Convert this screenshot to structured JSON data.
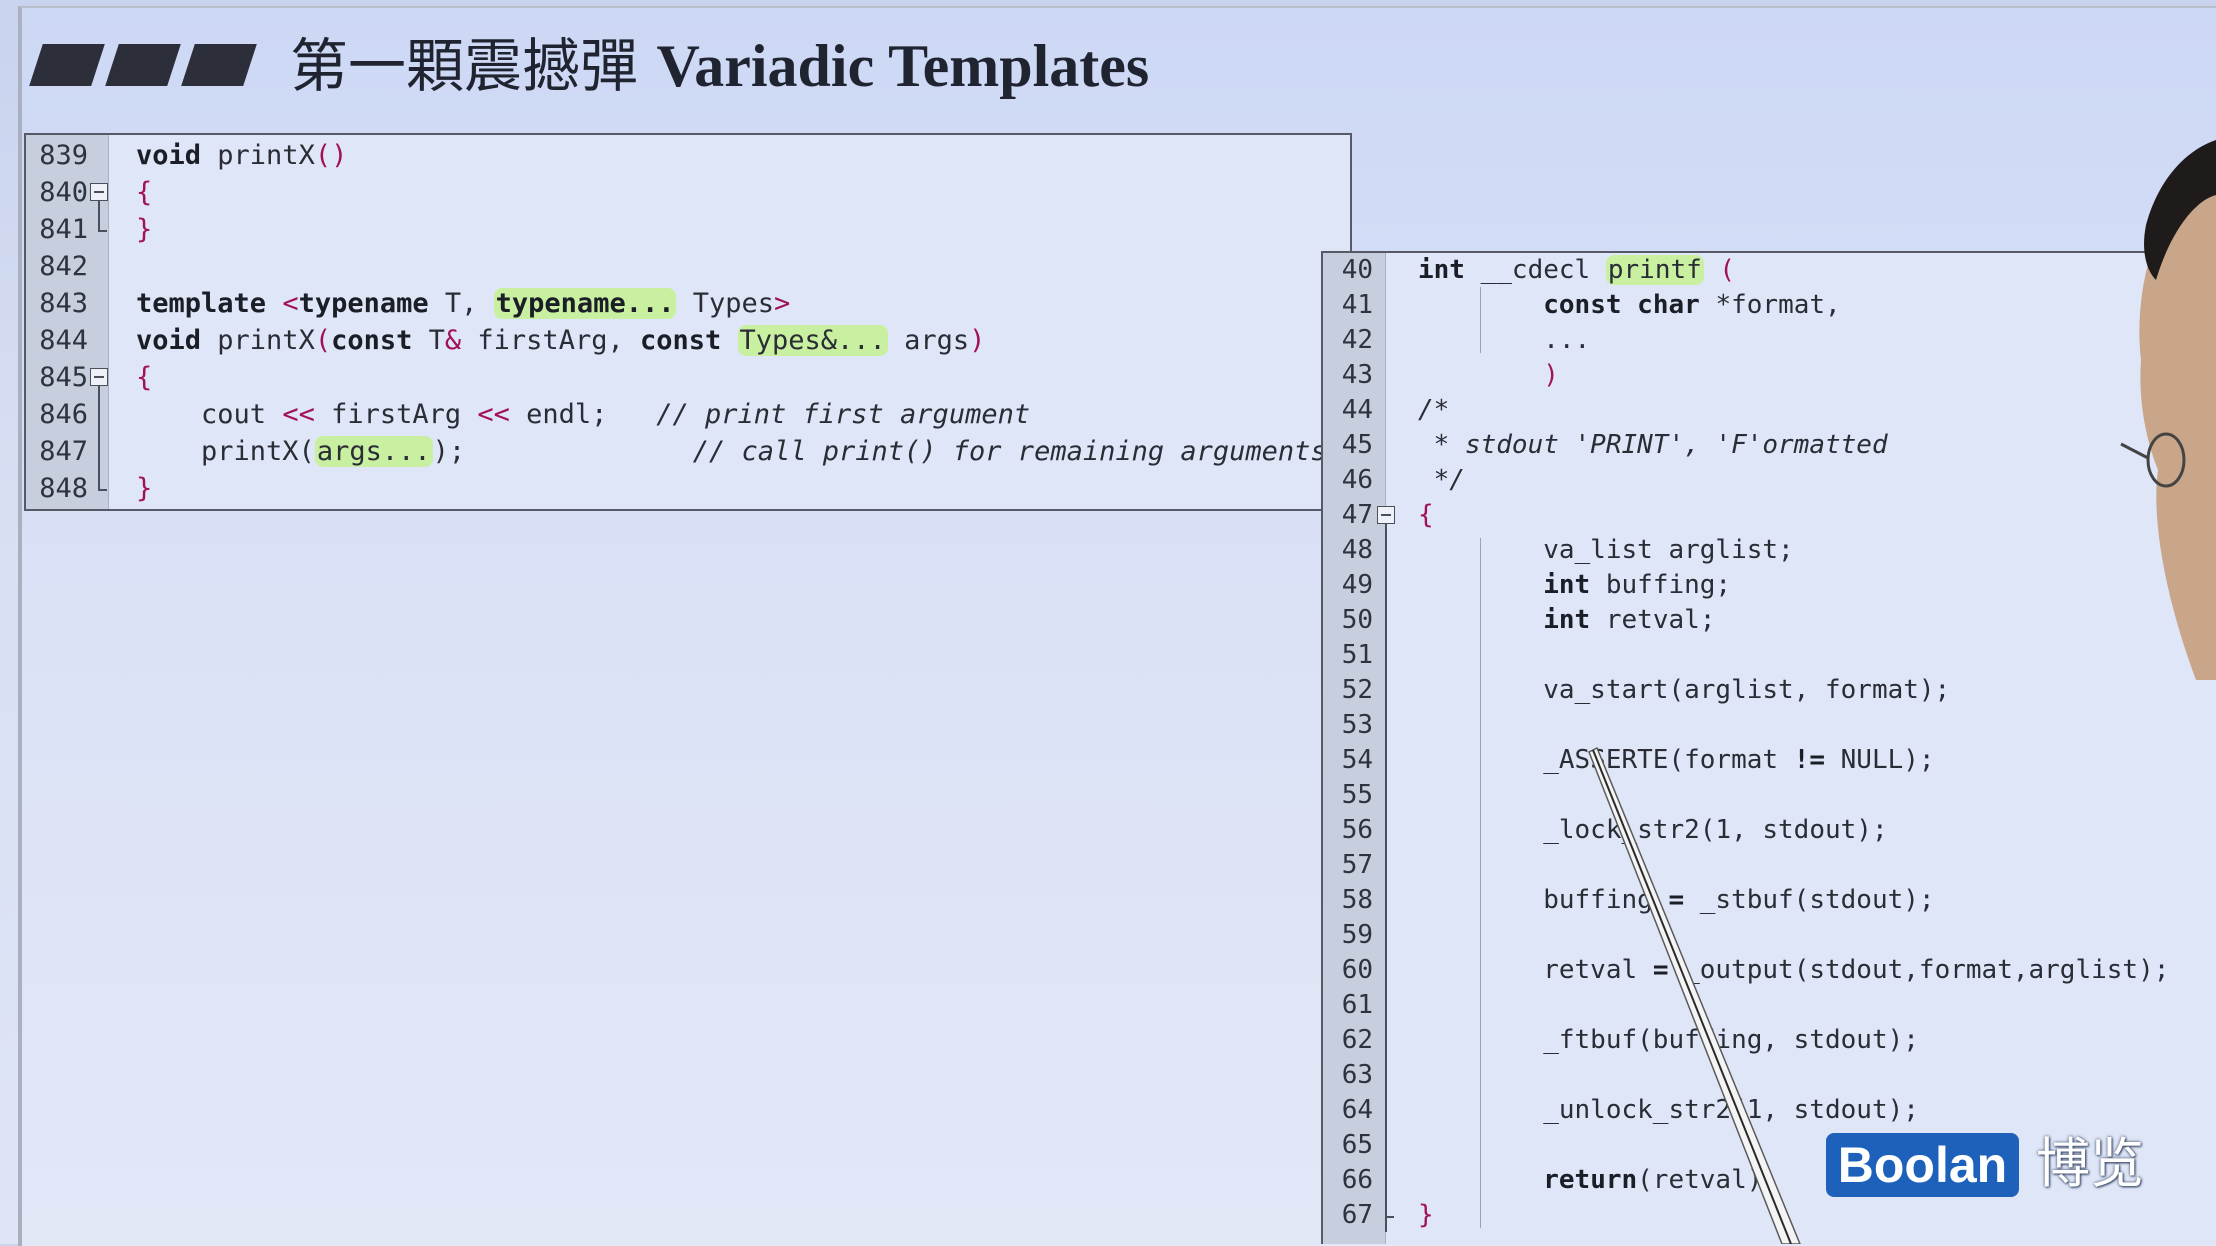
{
  "slide": {
    "title_cn": "第一顆震撼彈 ",
    "title_en": "Variadic Templates"
  },
  "left_code": {
    "lines": [
      {
        "num": "839",
        "parts": [
          {
            "t": "void",
            "c": "kw"
          },
          {
            "t": " printX",
            "c": ""
          },
          {
            "t": "()",
            "c": "pn"
          }
        ]
      },
      {
        "num": "840",
        "fold": "open",
        "parts": [
          {
            "t": "{",
            "c": "pn"
          }
        ]
      },
      {
        "num": "841",
        "fold": "end",
        "parts": [
          {
            "t": "}",
            "c": "pn"
          }
        ]
      },
      {
        "num": "842",
        "parts": []
      },
      {
        "num": "843",
        "parts": [
          {
            "t": "template",
            "c": "kw"
          },
          {
            "t": " ",
            "c": ""
          },
          {
            "t": "<",
            "c": "pn"
          },
          {
            "t": "typename",
            "c": "kw"
          },
          {
            "t": " T, ",
            "c": ""
          },
          {
            "t": "typename...",
            "c": "kw hl"
          },
          {
            "t": " Types",
            "c": ""
          },
          {
            "t": ">",
            "c": "pn"
          }
        ]
      },
      {
        "num": "844",
        "parts": [
          {
            "t": "void",
            "c": "kw"
          },
          {
            "t": " printX",
            "c": ""
          },
          {
            "t": "(",
            "c": "pn"
          },
          {
            "t": "const",
            "c": "kw"
          },
          {
            "t": " T",
            "c": ""
          },
          {
            "t": "&",
            "c": "pn"
          },
          {
            "t": " firstArg, ",
            "c": ""
          },
          {
            "t": "const",
            "c": "kw"
          },
          {
            "t": " ",
            "c": ""
          },
          {
            "t": "Types&...",
            "c": "hl"
          },
          {
            "t": " args",
            "c": ""
          },
          {
            "t": ")",
            "c": "pn"
          }
        ]
      },
      {
        "num": "845",
        "fold": "open",
        "parts": [
          {
            "t": "{",
            "c": "pn"
          }
        ]
      },
      {
        "num": "846",
        "parts": [
          {
            "t": "    cout ",
            "c": ""
          },
          {
            "t": "<<",
            "c": "pn"
          },
          {
            "t": " firstArg ",
            "c": ""
          },
          {
            "t": "<<",
            "c": "pn"
          },
          {
            "t": " endl;   ",
            "c": ""
          },
          {
            "t": "// print first argument",
            "c": "cm"
          }
        ]
      },
      {
        "num": "847",
        "parts": [
          {
            "t": "    printX(",
            "c": ""
          },
          {
            "t": "args...",
            "c": "hl"
          },
          {
            "t": ");              ",
            "c": ""
          },
          {
            "t": "// call print() for remaining arguments",
            "c": "cm"
          }
        ]
      },
      {
        "num": "848",
        "fold": "end",
        "parts": [
          {
            "t": "}",
            "c": "pn"
          }
        ]
      }
    ]
  },
  "right_code": {
    "lines": [
      {
        "num": "40",
        "parts": [
          {
            "t": "int",
            "c": "kw"
          },
          {
            "t": " __cdecl ",
            "c": ""
          },
          {
            "t": "printf",
            "c": "hl"
          },
          {
            "t": " (",
            "c": "pn"
          }
        ]
      },
      {
        "num": "41",
        "parts": [
          {
            "t": "        ",
            "c": ""
          },
          {
            "t": "const",
            "c": "kw"
          },
          {
            "t": " ",
            "c": ""
          },
          {
            "t": "char",
            "c": "kw"
          },
          {
            "t": " *format,",
            "c": ""
          }
        ]
      },
      {
        "num": "42",
        "parts": [
          {
            "t": "        ...",
            "c": ""
          }
        ]
      },
      {
        "num": "43",
        "parts": [
          {
            "t": "        ",
            "c": ""
          },
          {
            "t": ")",
            "c": "pn"
          }
        ]
      },
      {
        "num": "44",
        "parts": [
          {
            "t": "/*",
            "c": "cm"
          }
        ]
      },
      {
        "num": "45",
        "parts": [
          {
            "t": " * stdout 'PRINT', 'F'ormatted",
            "c": "cm"
          }
        ]
      },
      {
        "num": "46",
        "parts": [
          {
            "t": " */",
            "c": "cm"
          }
        ]
      },
      {
        "num": "47",
        "fold": "open",
        "parts": [
          {
            "t": "{",
            "c": "pn"
          }
        ]
      },
      {
        "num": "48",
        "parts": [
          {
            "t": "        va_list arglist;",
            "c": ""
          }
        ]
      },
      {
        "num": "49",
        "parts": [
          {
            "t": "        ",
            "c": ""
          },
          {
            "t": "int",
            "c": "kw"
          },
          {
            "t": " buffing;",
            "c": ""
          }
        ]
      },
      {
        "num": "50",
        "parts": [
          {
            "t": "        ",
            "c": ""
          },
          {
            "t": "int",
            "c": "kw"
          },
          {
            "t": " retval;",
            "c": ""
          }
        ]
      },
      {
        "num": "51",
        "parts": []
      },
      {
        "num": "52",
        "parts": [
          {
            "t": "        va_start(arglist, format);",
            "c": ""
          }
        ]
      },
      {
        "num": "53",
        "parts": []
      },
      {
        "num": "54",
        "parts": [
          {
            "t": "        _ASSERTE(format ",
            "c": ""
          },
          {
            "t": "!=",
            "c": "kw"
          },
          {
            "t": " NULL);",
            "c": ""
          }
        ]
      },
      {
        "num": "55",
        "parts": []
      },
      {
        "num": "56",
        "parts": [
          {
            "t": "        _lock_str2(1, stdout);",
            "c": ""
          }
        ]
      },
      {
        "num": "57",
        "parts": []
      },
      {
        "num": "58",
        "parts": [
          {
            "t": "        buffing ",
            "c": ""
          },
          {
            "t": "=",
            "c": "kw"
          },
          {
            "t": " _stbuf(stdout);",
            "c": ""
          }
        ]
      },
      {
        "num": "59",
        "parts": []
      },
      {
        "num": "60",
        "parts": [
          {
            "t": "        retval ",
            "c": ""
          },
          {
            "t": "=",
            "c": "kw"
          },
          {
            "t": " _output(stdout,format,arglist);",
            "c": ""
          }
        ]
      },
      {
        "num": "61",
        "parts": []
      },
      {
        "num": "62",
        "parts": [
          {
            "t": "        _ftbuf(buffing, stdout);",
            "c": ""
          }
        ]
      },
      {
        "num": "63",
        "parts": []
      },
      {
        "num": "64",
        "parts": [
          {
            "t": "        _unlock_str2(1, stdout);",
            "c": ""
          }
        ]
      },
      {
        "num": "65",
        "parts": []
      },
      {
        "num": "66",
        "parts": [
          {
            "t": "        ",
            "c": ""
          },
          {
            "t": "return",
            "c": "kw"
          },
          {
            "t": "(retval);",
            "c": ""
          }
        ]
      },
      {
        "num": "67",
        "fold": "end",
        "parts": [
          {
            "t": "}",
            "c": "pn"
          }
        ]
      }
    ]
  },
  "brand": {
    "logo": "Boolan",
    "logo_cn": "博览",
    "logo_color": "#1d61ba"
  }
}
